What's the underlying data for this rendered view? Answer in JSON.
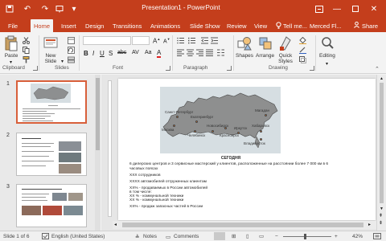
{
  "titlebar": {
    "title": "Presentation1 - PowerPoint",
    "user": "Merced Fl...",
    "share": "Share",
    "accent": "#c43e1c"
  },
  "tabs": [
    "File",
    "Home",
    "Insert",
    "Design",
    "Transitions",
    "Animations",
    "Slide Show",
    "Review",
    "View"
  ],
  "tell_me": "Tell me...",
  "ribbon": {
    "paste": "Paste",
    "new_slide_1": "New",
    "new_slide_2": "Slide",
    "shapes": "Shapes",
    "arrange": "Arrange",
    "quick_styles_1": "Quick",
    "quick_styles_2": "Styles",
    "editing": "Editing",
    "groups": {
      "clipboard": "Clipboard",
      "slides": "Slides",
      "font": "Font",
      "paragraph": "Paragraph",
      "drawing": "Drawing"
    }
  },
  "thumbnails": [
    {
      "num": "1"
    },
    {
      "num": "2"
    },
    {
      "num": "3"
    }
  ],
  "slide": {
    "title": "СЕГОДНЯ",
    "lines": [
      "6 дилерских центров и 3 сервисные мастерский у клиентов, расположенные на расстоянии более 7 000 км в 6",
      "часовых поясах",
      "XXX сотрудников",
      "XXXX автомобилей отгруженных клиентам",
      "XX% - продаваемых в России автомобилей",
      "в том числе:",
      "XX % - коммунальной техники",
      "XX % - коммунальной техники",
      "XX% - продаж запасных частей в России"
    ],
    "cities": [
      "Санкт-Петербург",
      "Москва",
      "Екатеринбург",
      "Челябинск",
      "Новосибирск",
      "Красноярск",
      "Иркутск",
      "Хабаровск",
      "Владивосток",
      "Магадан"
    ]
  },
  "status": {
    "slide_of": "Slide 1 of 6",
    "language": "English (United States)",
    "notes": "Notes",
    "comments": "Comments",
    "zoom_minus": "−",
    "zoom_plus": "+",
    "zoom": "42%"
  }
}
